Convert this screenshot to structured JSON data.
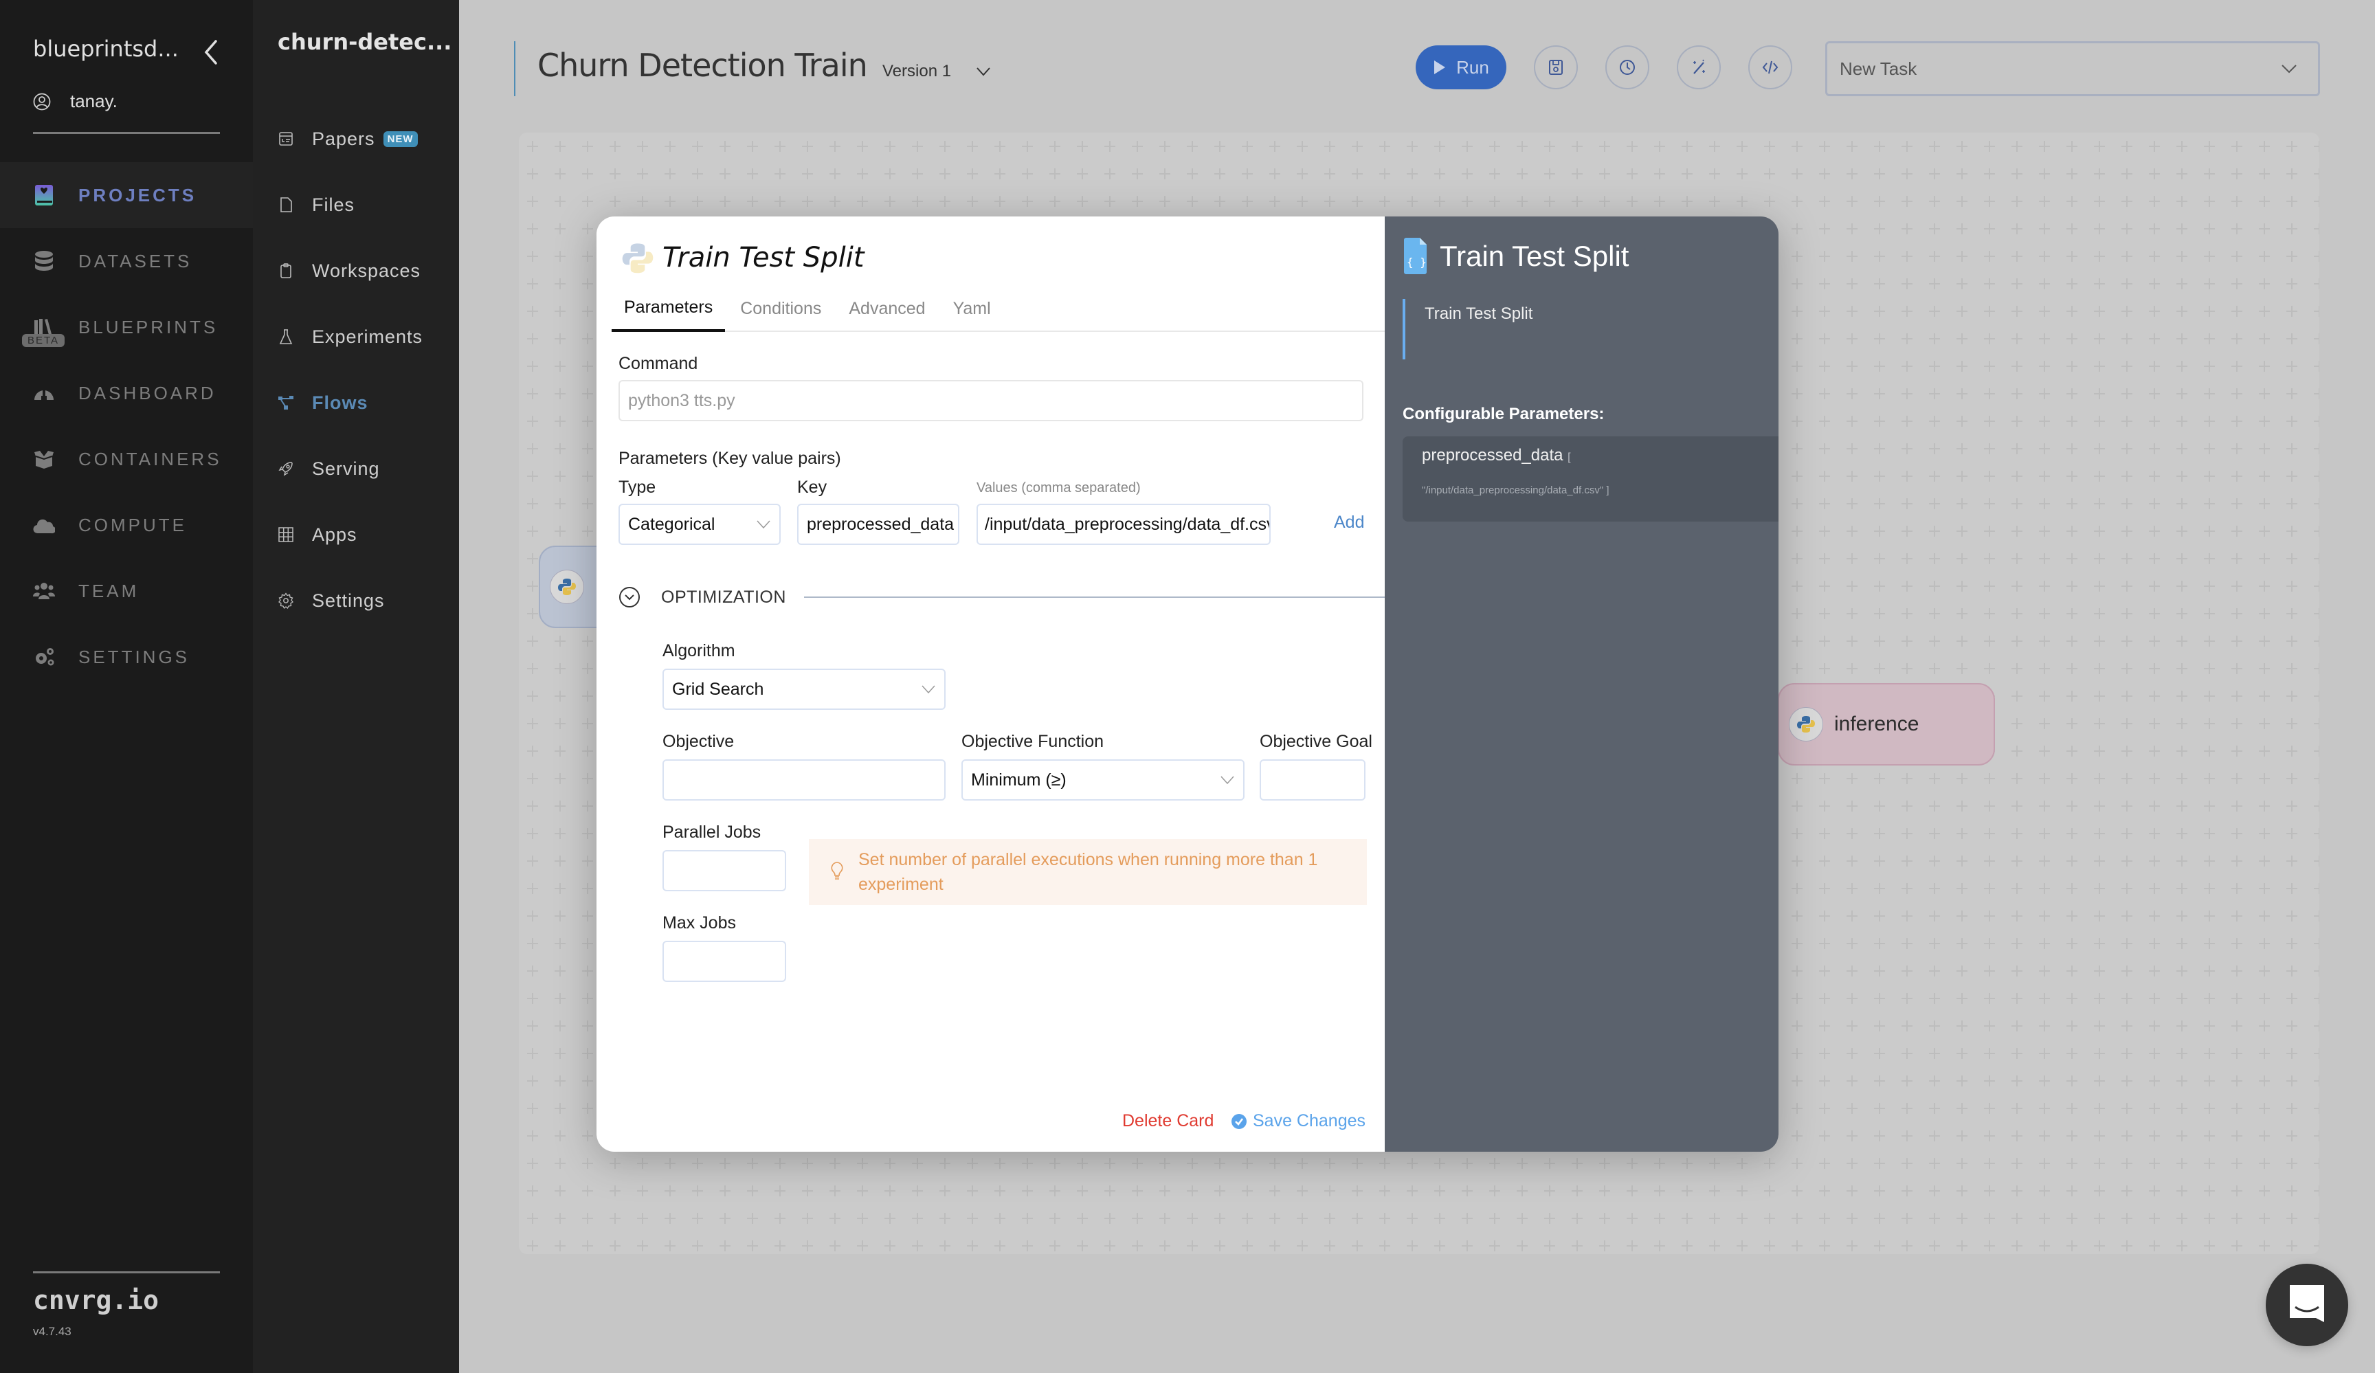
{
  "sidebar": {
    "org_name": "blueprintsd...",
    "user_name": "tanay.",
    "items": [
      {
        "label": "PROJECTS",
        "icon": "projects-icon",
        "active": true
      },
      {
        "label": "DATASETS",
        "icon": "datasets-icon"
      },
      {
        "label": "BLUEPRINTS",
        "icon": "blueprints-icon",
        "badge": "BETA"
      },
      {
        "label": "DASHBOARD",
        "icon": "dashboard-icon"
      },
      {
        "label": "CONTAINERS",
        "icon": "containers-icon"
      },
      {
        "label": "COMPUTE",
        "icon": "compute-icon"
      },
      {
        "label": "TEAM",
        "icon": "team-icon"
      },
      {
        "label": "SETTINGS",
        "icon": "settings-icon"
      }
    ],
    "brand": "cnvrg.io",
    "version": "v4.7.43"
  },
  "project_nav": {
    "project_name": "churn-detec...",
    "items": [
      {
        "label": "Papers",
        "icon": "papers-icon",
        "badge": "NEW"
      },
      {
        "label": "Files",
        "icon": "file-icon"
      },
      {
        "label": "Workspaces",
        "icon": "clipboard-icon"
      },
      {
        "label": "Experiments",
        "icon": "flask-icon"
      },
      {
        "label": "Flows",
        "icon": "flows-icon",
        "active": true
      },
      {
        "label": "Serving",
        "icon": "rocket-icon"
      },
      {
        "label": "Apps",
        "icon": "grid-icon"
      },
      {
        "label": "Settings",
        "icon": "gear-icon"
      }
    ]
  },
  "header": {
    "flow_title": "Churn Detection Train",
    "version_label": "Version 1",
    "run_label": "Run",
    "toolbar_icons": [
      "save-icon",
      "history-icon",
      "magic-wand-icon",
      "code-icon"
    ],
    "task_select": "New Task"
  },
  "canvas": {
    "nodes": [
      {
        "label": "inference",
        "icon": "python-icon",
        "color": "#d0b9c2"
      }
    ]
  },
  "modal": {
    "title": "Train Test Split",
    "tabs": [
      "Parameters",
      "Conditions",
      "Advanced",
      "Yaml"
    ],
    "active_tab": "Parameters",
    "command": {
      "label": "Command",
      "placeholder": "python3 tts.py"
    },
    "parameters": {
      "section_label": "Parameters (Key value pairs)",
      "type_label": "Type",
      "type_value": "Categorical",
      "key_label": "Key",
      "key_value": "preprocessed_data",
      "values_label": "Values (comma separated)",
      "values_value": "/input/data_preprocessing/data_df.csv",
      "add_label": "Add"
    },
    "optimization": {
      "section_label": "OPTIMIZATION",
      "algorithm_label": "Algorithm",
      "algorithm_value": "Grid Search",
      "objective_label": "Objective",
      "objective_value": "",
      "objective_function_label": "Objective Function",
      "objective_function_value": "Minimum (≥)",
      "objective_goal_label": "Objective Goal",
      "objective_goal_value": "",
      "parallel_jobs_label": "Parallel Jobs",
      "parallel_jobs_value": "",
      "hint": "Set number of parallel executions when running more than 1 experiment",
      "max_jobs_label": "Max Jobs",
      "max_jobs_value": ""
    },
    "delete_label": "Delete Card",
    "save_label": "Save Changes",
    "info_panel": {
      "title": "Train Test Split",
      "description": "Train Test Split",
      "config_heading": "Configurable Parameters:",
      "param_key": "preprocessed_data",
      "param_open": "[",
      "param_value": "\"/input/data_preprocessing/data_df.csv\" ]"
    }
  },
  "colors": {
    "accent_blue": "#3566bc",
    "active_flows": "#5b8ab5",
    "delete_red": "#e03a30",
    "save_blue": "#5aa3ea",
    "hint_orange": "#e49c5c"
  }
}
